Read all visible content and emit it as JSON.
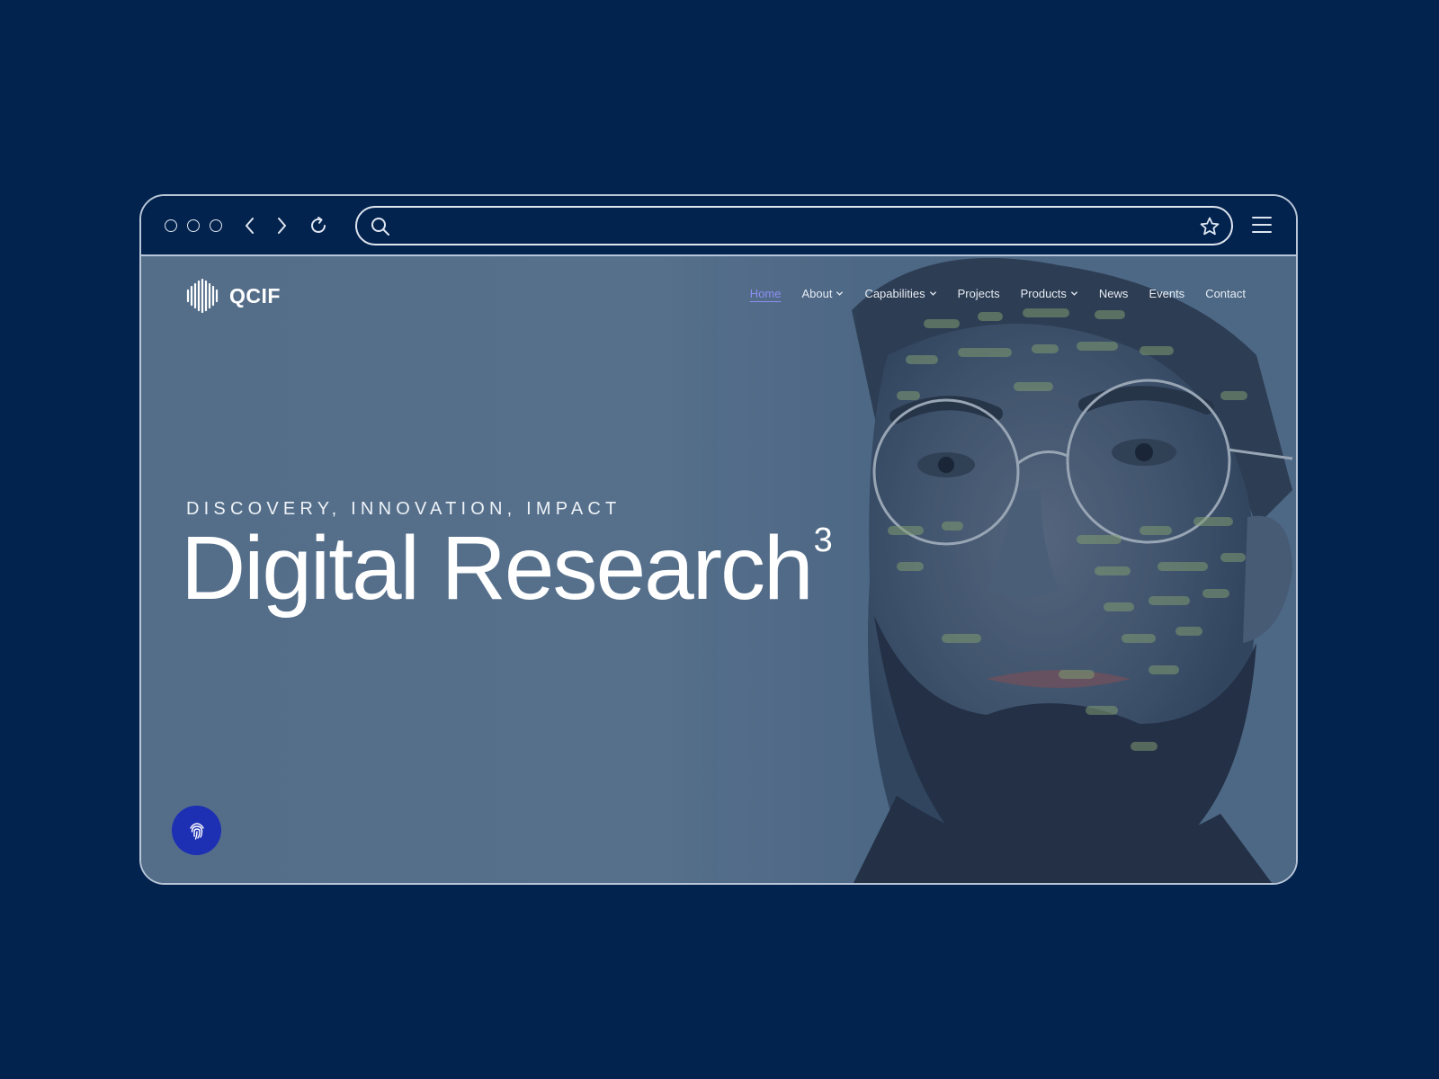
{
  "browser": {
    "url": "",
    "icons": [
      "window-dot-icon",
      "back-icon",
      "forward-icon",
      "reload-icon",
      "search-icon",
      "star-icon",
      "menu-icon"
    ]
  },
  "site": {
    "logo_text": "QCIF",
    "nav": [
      {
        "label": "Home",
        "active": true,
        "dropdown": false
      },
      {
        "label": "About",
        "active": false,
        "dropdown": true
      },
      {
        "label": "Capabilities",
        "active": false,
        "dropdown": true
      },
      {
        "label": "Projects",
        "active": false,
        "dropdown": false
      },
      {
        "label": "Products",
        "active": false,
        "dropdown": true
      },
      {
        "label": "News",
        "active": false,
        "dropdown": false
      },
      {
        "label": "Events",
        "active": false,
        "dropdown": false
      },
      {
        "label": "Contact",
        "active": false,
        "dropdown": false
      }
    ],
    "hero": {
      "tagline": "DISCOVERY, INNOVATION, IMPACT",
      "headline": "Digital Research",
      "headline_superscript": "3"
    }
  },
  "colors": {
    "page_background": "#03234f",
    "nav_active": "#8c8ff2",
    "fingerprint_button": "#1d2fb3"
  }
}
